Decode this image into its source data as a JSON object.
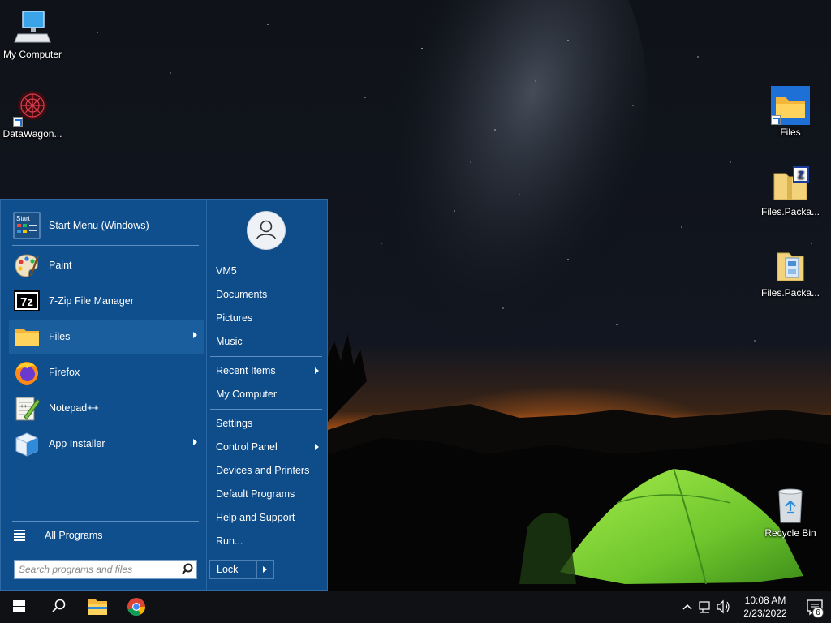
{
  "desktop": {
    "left_icons": [
      {
        "label": "My Computer",
        "icon": "computer-monitor-icon"
      },
      {
        "label": "DataWagon...",
        "icon": "datawagon-app-icon"
      }
    ],
    "right_icons": [
      {
        "label": "Files",
        "icon": "folder-icon"
      },
      {
        "label": "Files.Packa...",
        "icon": "zip-folder-icon"
      },
      {
        "label": "Files.Packa...",
        "icon": "installer-package-icon"
      },
      {
        "label": "Recycle Bin",
        "icon": "recycle-bin-icon"
      }
    ]
  },
  "start_menu": {
    "pinned": [
      {
        "label": "Start Menu (Windows)",
        "icon": "start-menu-settings-icon"
      }
    ],
    "programs": [
      {
        "label": "Paint",
        "icon": "paint-palette-icon",
        "submenu": false
      },
      {
        "label": "7-Zip File Manager",
        "icon": "7zip-icon",
        "submenu": false
      },
      {
        "label": "Files",
        "icon": "folder-icon",
        "submenu": true,
        "active": true
      },
      {
        "label": "Firefox",
        "icon": "firefox-icon",
        "submenu": false
      },
      {
        "label": "Notepad++",
        "icon": "notepad-plus-plus-icon",
        "submenu": false
      },
      {
        "label": "App Installer",
        "icon": "app-installer-box-icon",
        "submenu": true
      }
    ],
    "all_programs_label": "All Programs",
    "search_placeholder": "Search programs and files",
    "right": {
      "user_icon": "user-avatar-icon",
      "items": [
        {
          "label": "VM5"
        },
        {
          "label": "Documents"
        },
        {
          "label": "Pictures"
        },
        {
          "label": "Music"
        },
        {
          "label": "Recent Items",
          "submenu": true
        },
        {
          "label": "My Computer"
        },
        {
          "label": "Settings"
        },
        {
          "label": "Control Panel",
          "submenu": true
        },
        {
          "label": "Devices and Printers"
        },
        {
          "label": "Default Programs"
        },
        {
          "label": "Help and Support"
        },
        {
          "label": "Run..."
        }
      ],
      "lock_label": "Lock"
    }
  },
  "taskbar": {
    "buttons": [
      "windows-start-icon",
      "search-icon",
      "file-explorer-icon",
      "chrome-icon"
    ],
    "tray_icons": [
      "chevron-up-icon",
      "network-icon",
      "volume-icon"
    ],
    "time": "10:08 AM",
    "date": "2/23/2022",
    "notification_count": "6"
  },
  "colors": {
    "start_menu_bg": "#0f4f8e",
    "taskbar_bg": "#101114",
    "tent_green": "#7fd43a"
  }
}
